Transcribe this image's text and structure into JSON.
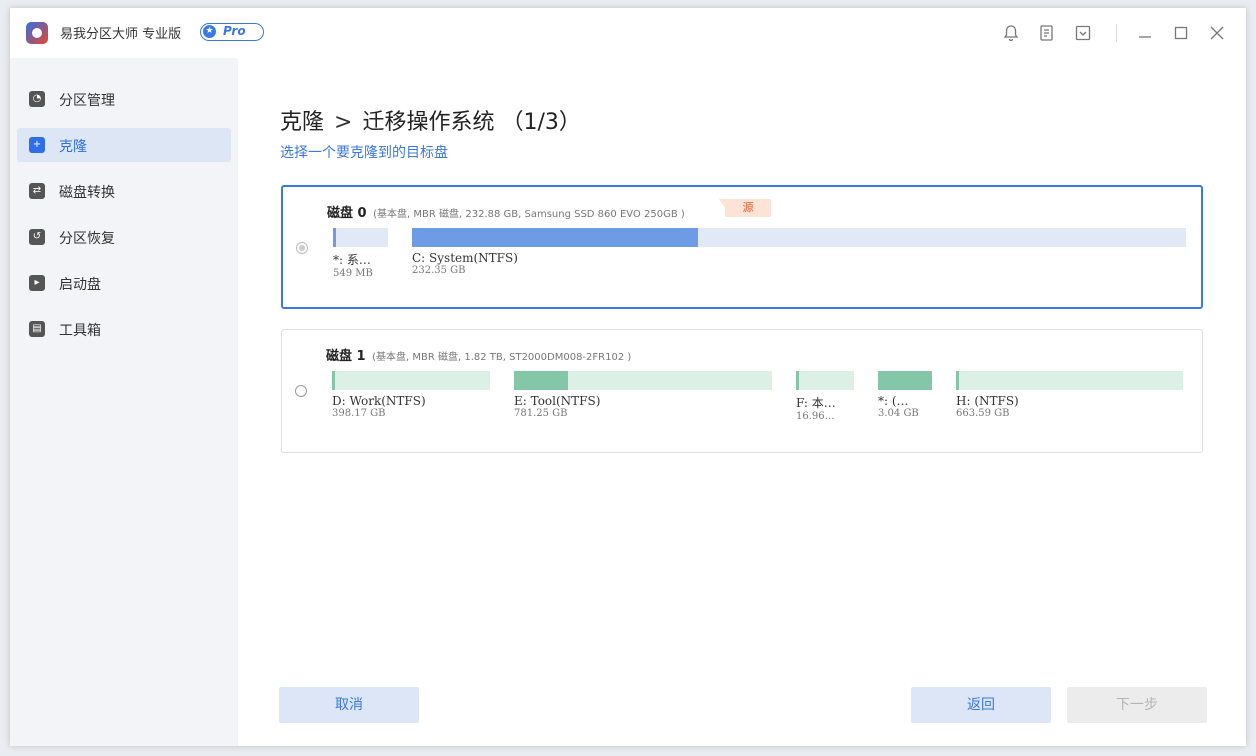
{
  "app": {
    "title": "易我分区大师 专业版",
    "pro_label": "Pro"
  },
  "titlebar_icons": [
    "bell-icon",
    "notes-icon",
    "dropdown-icon",
    "minimize-icon",
    "maximize-icon",
    "close-icon"
  ],
  "sidebar": {
    "items": [
      {
        "label": "分区管理",
        "icon": "pie-chart-icon",
        "active": false
      },
      {
        "label": "克隆",
        "icon": "clone-icon",
        "active": true
      },
      {
        "label": "磁盘转换",
        "icon": "convert-icon",
        "active": false
      },
      {
        "label": "分区恢复",
        "icon": "recovery-icon",
        "active": false
      },
      {
        "label": "启动盘",
        "icon": "boot-disk-icon",
        "active": false
      },
      {
        "label": "工具箱",
        "icon": "toolbox-icon",
        "active": false
      }
    ]
  },
  "main": {
    "breadcrumb_root": "克隆",
    "breadcrumb_sep": ">",
    "breadcrumb_current": "迁移操作系统",
    "step": "（1/3）",
    "subtitle": "选择一个要克隆到的目标盘"
  },
  "disks": [
    {
      "name": "磁盘 0",
      "info": "(基本盘, MBR 磁盘, 232.88 GB, Samsung SSD 860 EVO 250GB )",
      "tag": "源",
      "selected": true,
      "partitions": [
        {
          "label": "*: 系…",
          "size": "549 MB",
          "used_fraction": 0.05
        },
        {
          "label": "C: System(NTFS)",
          "size": "232.35 GB",
          "used_fraction": 0.37
        }
      ]
    },
    {
      "name": "磁盘 1",
      "info": "(基本盘, MBR 磁盘, 1.82 TB, ST2000DM008-2FR102 )",
      "tag": "",
      "selected": false,
      "partitions": [
        {
          "label": "D: Work(NTFS)",
          "size": "398.17 GB",
          "used_fraction": 0.01
        },
        {
          "label": "E: Tool(NTFS)",
          "size": "781.25 GB",
          "used_fraction": 0.21
        },
        {
          "label": "F: 本…",
          "size": "16.96…",
          "used_fraction": 0.03
        },
        {
          "label": "*: (…",
          "size": "3.04 GB",
          "used_fraction": 1.0
        },
        {
          "label": "H: (NTFS)",
          "size": "663.59 GB",
          "used_fraction": 0.01
        }
      ]
    }
  ],
  "buttons": {
    "cancel": "取消",
    "back": "返回",
    "next": "下一步"
  },
  "colors": {
    "accent": "#3a78e6",
    "disk0_fill": "#6d9be6",
    "disk0_track": "#e1e8f6",
    "disk1_fill": "#83c6a8",
    "disk1_track": "#dcf0e5",
    "source_tag_bg": "#fde3d5",
    "source_tag_text": "#e55a2a"
  }
}
